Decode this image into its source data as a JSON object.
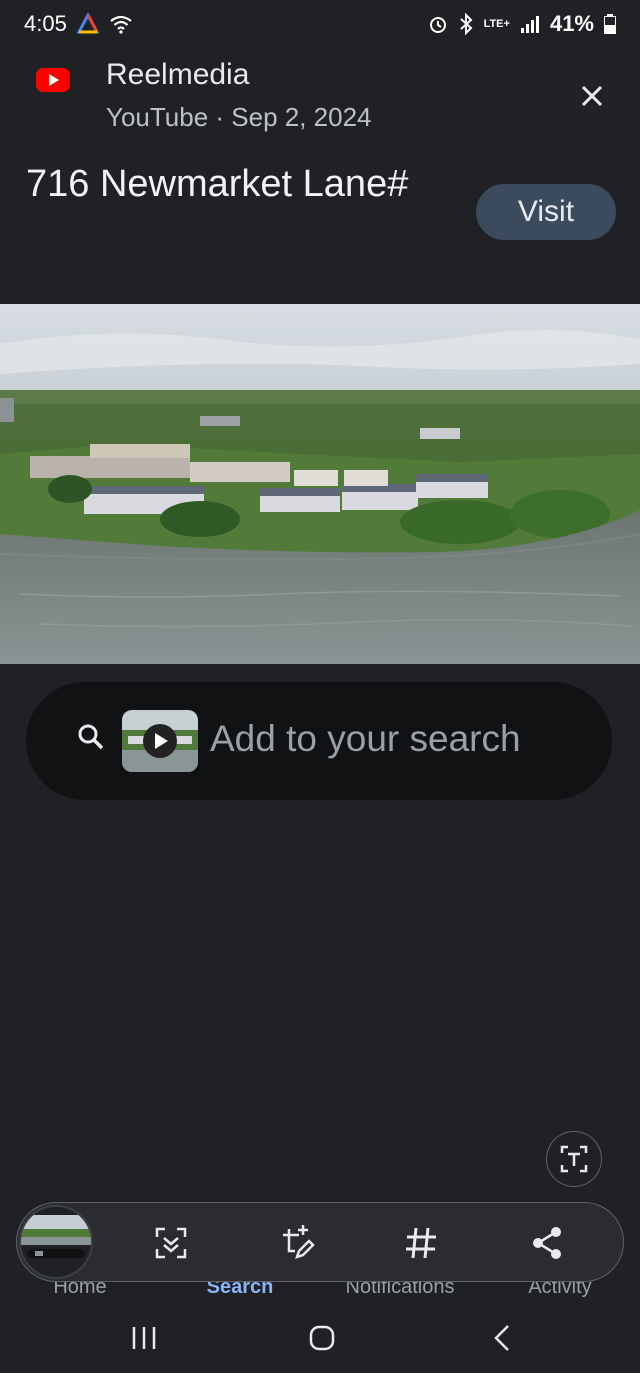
{
  "status_bar": {
    "time": "4:05",
    "battery_percent": "41%",
    "network_label": "LTE+"
  },
  "source": {
    "name": "Reelmedia",
    "meta": "YouTube · Sep 2, 2024",
    "icon": "youtube-logo"
  },
  "result": {
    "title": "716 Newmarket Lane#",
    "visit_label": "Visit"
  },
  "search": {
    "placeholder": "Add to your search",
    "icon": "search-icon"
  },
  "bottom_tabs": [
    {
      "label": "Home",
      "active": false
    },
    {
      "label": "Search",
      "active": true
    },
    {
      "label": "Notifications",
      "active": false
    },
    {
      "label": "Activity",
      "active": false
    }
  ],
  "toolbar": {
    "buttons": [
      "lens-scan-icon",
      "edit-crop-icon",
      "hashtag-icon",
      "share-icon"
    ]
  },
  "colors": {
    "background": "#202124",
    "accent": "#8ab4f8",
    "visit_button": "#3c4a5e",
    "youtube_red": "#ff0000"
  }
}
